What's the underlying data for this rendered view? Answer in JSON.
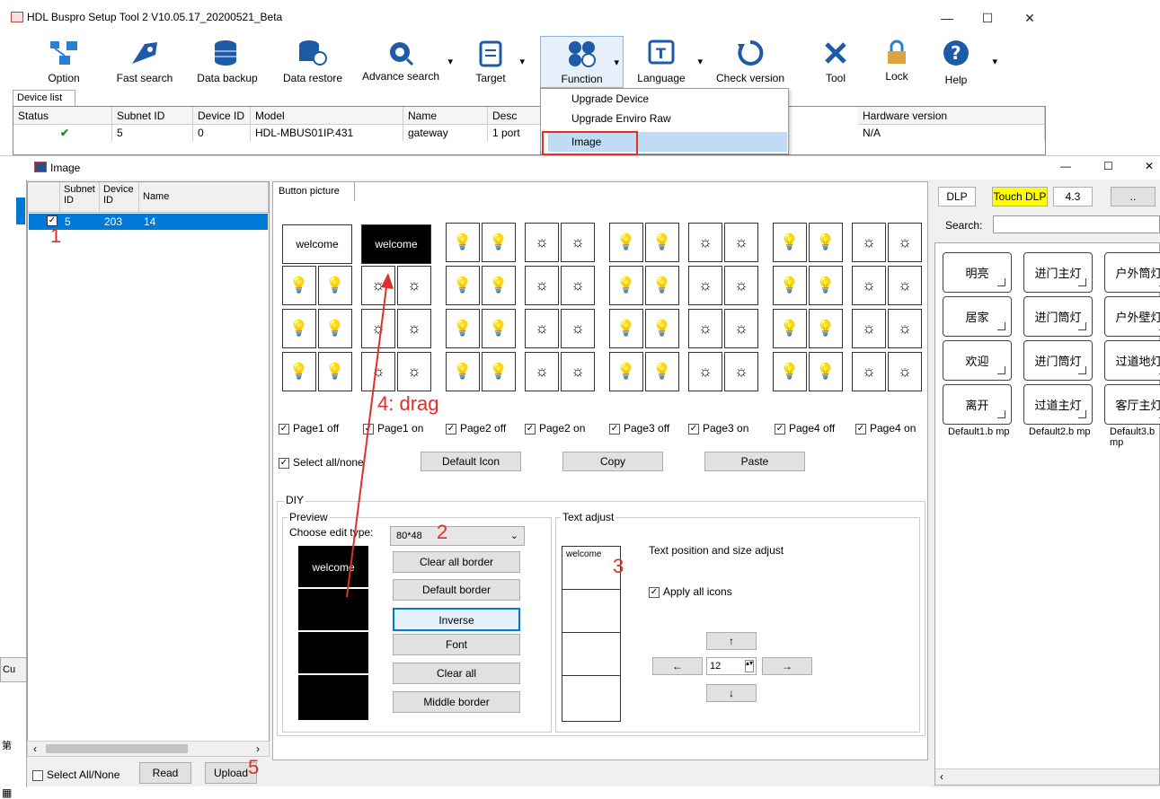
{
  "app": {
    "title": "HDL Buspro Setup Tool 2 V10.05.17_20200521_Beta"
  },
  "toolbar": [
    {
      "label": "Option",
      "icon": "network-icon"
    },
    {
      "label": "Fast search",
      "icon": "rocket-icon"
    },
    {
      "label": "Data backup",
      "icon": "database-icon"
    },
    {
      "label": "Data restore",
      "icon": "database-restore-icon"
    },
    {
      "label": "Advance search",
      "icon": "gear-search-icon"
    },
    {
      "label": "Target",
      "icon": "clipboard-icon"
    },
    {
      "label": "Function",
      "icon": "function-icon"
    },
    {
      "label": "Language",
      "icon": "text-icon"
    },
    {
      "label": "Check version",
      "icon": "refresh-icon"
    },
    {
      "label": "Tool",
      "icon": "tools-icon"
    },
    {
      "label": "Lock",
      "icon": "lock-icon"
    },
    {
      "label": "Help",
      "icon": "help-icon"
    }
  ],
  "device_list": {
    "tab": "Device list",
    "columns": [
      "Status",
      "Subnet ID",
      "Device ID",
      "Model",
      "Name",
      "Desc",
      "Hardware version"
    ],
    "row": {
      "subnet": "5",
      "device": "0",
      "model": "HDL-MBUS01IP.431",
      "name": "gateway",
      "desc": "1 port",
      "hw": "N/A"
    }
  },
  "function_menu": [
    "Upgrade Device",
    "Upgrade Enviro Raw",
    "Image"
  ],
  "image_window": {
    "title": "Image",
    "left_columns": [
      "Subnet ID",
      "Device ID",
      "Name"
    ],
    "left_row": {
      "subnet": "5",
      "device": "203",
      "name": "14"
    },
    "select_all": "Select All/None",
    "read": "Read",
    "upload": "Upload",
    "side_labels": [
      "Cu",
      "第"
    ],
    "tab": "Button picture",
    "welcome": "welcome",
    "pages": [
      "Page1 off",
      "Page1 on",
      "Page2 off",
      "Page2 on",
      "Page3 off",
      "Page3 on",
      "Page4 off",
      "Page4 on"
    ],
    "select_all_none": "Select all/none",
    "default_icon": "Default Icon",
    "copy": "Copy",
    "paste": "Paste",
    "diy": "DIY",
    "preview": "Preview",
    "edit_type_label": "Choose edit type:",
    "edit_type_value": "80*48",
    "diy_buttons": [
      "Clear all border",
      "Default border",
      "Inverse",
      "Font",
      "Clear all",
      "Middle border"
    ],
    "text_adjust": "Text adjust",
    "text_pos": "Text position and size adjust",
    "apply_all": "Apply all icons",
    "font_size": "12",
    "dlp": "DLP",
    "touch_dlp": "Touch DLP",
    "version": "4.3",
    "dots": "..",
    "search_label": "Search:",
    "presets": [
      [
        "明亮",
        "进门主灯",
        "户外筒灯"
      ],
      [
        "居家",
        "进门筒灯",
        "户外壁灯"
      ],
      [
        "欢迎",
        "进门筒灯",
        "过道地灯"
      ],
      [
        "离开",
        "过道主灯",
        "客厅主灯"
      ]
    ],
    "preset_files": [
      "Default1.b mp",
      "Default2.b mp",
      "Default3.b mp"
    ]
  },
  "annotations": [
    "1",
    "2",
    "3",
    "4: drag",
    "5"
  ],
  "colors": {
    "accent": "#0078d7",
    "annotation": "#e0302a",
    "touch_dlp": "#ffff00"
  }
}
